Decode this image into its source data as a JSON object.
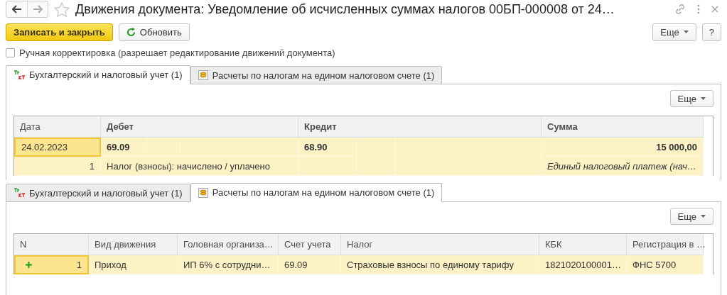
{
  "window": {
    "title": "Движения документа: Уведомление об исчисленных суммах налогов 00БП-000008 от 24…"
  },
  "toolbar": {
    "buttons": [
      {
        "kind": "primary",
        "label": "Записать и закрыть"
      },
      {
        "kind": "refresh",
        "label": "Обновить"
      }
    ],
    "more": "Еще",
    "help": "?"
  },
  "manual_correction": {
    "label": "Ручная корректировка (разрешает редактирование движений документа)",
    "checked": false
  },
  "views": [
    {
      "kind": "accounting",
      "tabs": [
        {
          "label": "Бухгалтерский и налоговый учет (1)",
          "kind": "ledger",
          "selected": true
        },
        {
          "label": "Расчеты по налогам на едином налоговом счете (1)",
          "kind": "coins",
          "selected": false
        }
      ],
      "more": "Еще",
      "table": {
        "columns": [
          "Дата",
          "Дебет",
          "Кредит",
          "Сумма"
        ],
        "rows": [
          {
            "selected": true,
            "date": "24.02.2023",
            "debit": "69.09",
            "credit": "68.90",
            "amount": "15 000,00",
            "number": "1",
            "debit_content": "Налог (взносы): начислено / уплачено",
            "amount_content": "Единый налоговый платеж (нач…"
          }
        ]
      }
    },
    {
      "kind": "tax",
      "tabs": [
        {
          "label": "Бухгалтерский и налоговый учет (1)",
          "kind": "ledger",
          "selected": false
        },
        {
          "label": "Расчеты по налогам на едином налоговом счете (1)",
          "kind": "coins",
          "selected": true
        }
      ],
      "more": "Еще",
      "table": {
        "columns": [
          "N",
          "Вид движения",
          "Головная организа…",
          "Счет учета",
          "Налог",
          "КБК",
          "Регистрация в …"
        ],
        "rows": [
          {
            "selected": true,
            "cells": [
              "1",
              "Приход",
              "ИП 6% с сотрудни…",
              "69.09",
              "Страховые взносы по единому тарифу",
              "1821020100001…",
              "ФНС 5700"
            ]
          }
        ]
      }
    }
  ]
}
